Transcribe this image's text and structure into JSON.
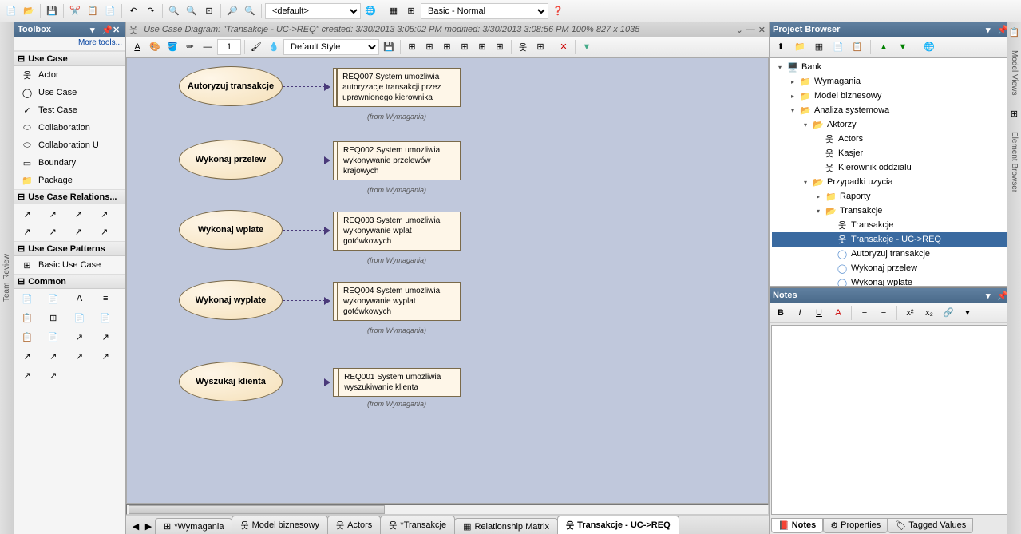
{
  "mainToolbar": {
    "combo1": "<default>",
    "combo2": "Basic - Normal"
  },
  "leftRail": {
    "label": "Team Review"
  },
  "toolbox": {
    "title": "Toolbox",
    "moreTools": "More tools...",
    "sections": {
      "useCase": "Use Case",
      "relations": "Use Case Relations...",
      "patterns": "Use Case Patterns",
      "common": "Common"
    },
    "items": {
      "actor": "Actor",
      "useCase": "Use Case",
      "testCase": "Test Case",
      "collaboration": "Collaboration",
      "collaborationU": "Collaboration U",
      "boundary": "Boundary",
      "package": "Package",
      "basicUseCase": "Basic Use Case"
    }
  },
  "canvas": {
    "headerTitle": "Use Case Diagram: \"Transakcje - UC->REQ\"  created: 3/30/2013 3:05:02 PM   modified: 3/30/2013 3:08:56 PM   100%   827 x 1035",
    "styleCombo": "Default Style",
    "lineNum": "1",
    "fromText": "(from Wymagania)",
    "usecases": {
      "uc1": "Autoryzuj transakcje",
      "uc2": "Wykonaj przelew",
      "uc3": "Wykonaj wplate",
      "uc4": "Wykonaj wyplate",
      "uc5": "Wyszukaj klienta"
    },
    "requirements": {
      "r1": "REQ007 System umozliwia autoryzacje transakcji przez uprawnionego kierownika",
      "r2": "REQ002 System umozliwia wykonywanie przelewów krajowych",
      "r3": "REQ003 System umozliwia wykonywanie wplat gotówkowych",
      "r4": "REQ004 System umozliwia wykonywanie wyplat gotówkowych",
      "r5": "REQ001 System umozliwia wyszukiwanie klienta"
    }
  },
  "tabs": {
    "t1": "*Wymagania",
    "t2": "Model biznesowy",
    "t3": "Actors",
    "t4": "*Transakcje",
    "t5": "Relationship Matrix",
    "t6": "Transakcje - UC->REQ"
  },
  "projectBrowser": {
    "title": "Project Browser",
    "tree": {
      "bank": "Bank",
      "wymagania": "Wymagania",
      "modelBiznesowy": "Model biznesowy",
      "analizaSystemowa": "Analiza systemowa",
      "aktorzy": "Aktorzy",
      "actors": "Actors",
      "kasjer": "Kasjer",
      "kierownik": "Kierownik oddzialu",
      "przypadki": "Przypadki uzycia",
      "raporty": "Raporty",
      "transakcje": "Transakcje",
      "transakcjeDiag": "Transakcje",
      "transakcjeReq": "Transakcje - UC->REQ",
      "autoryzuj": "Autoryzuj transakcje",
      "wykonajPrzelew": "Wykonaj przelew",
      "wykonajWplate": "Wykonaj wplate"
    }
  },
  "notes": {
    "title": "Notes",
    "tabs": {
      "notes": "Notes",
      "properties": "Properties",
      "tagged": "Tagged Values"
    }
  },
  "rightRail": {
    "modelViews": "Model Views",
    "elementBrowser": "Element Browser"
  }
}
